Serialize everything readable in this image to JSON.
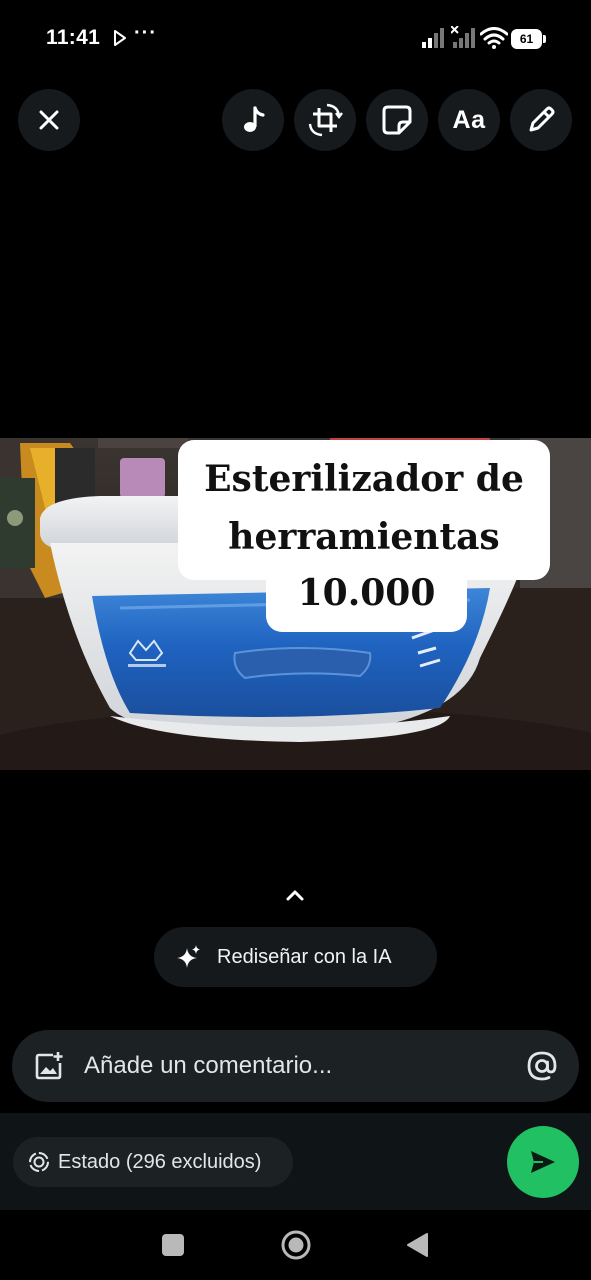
{
  "status_bar": {
    "time": "11:41",
    "dots": "···",
    "battery_level": "61"
  },
  "toolbar": {
    "close_icon": "close-icon",
    "music_icon": "music-note-icon",
    "crop_icon": "crop-rotate-icon",
    "sticker_icon": "sticker-icon",
    "text_label": "Aa",
    "draw_icon": "pencil-icon"
  },
  "photo": {
    "caption_lines": [
      "Esterilizador de",
      "herramientas",
      "10.000"
    ]
  },
  "editor": {
    "expand_icon": "chevron-up-icon",
    "ai_redesign_label": "Rediseñar con la IA"
  },
  "comment": {
    "placeholder": "Añade un comentario...",
    "value": ""
  },
  "audience": {
    "label": "Estado (296 excluidos)"
  },
  "colors": {
    "send_button": "#21c063",
    "control_bg": "#161a1d",
    "comment_bg": "#1c2124"
  }
}
